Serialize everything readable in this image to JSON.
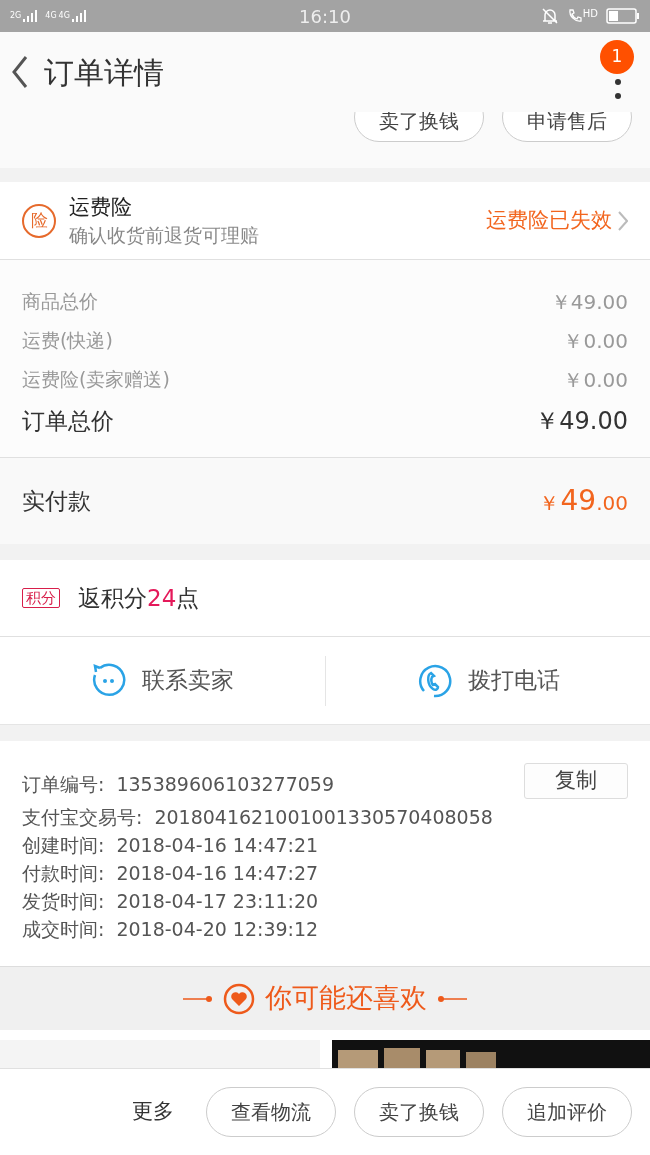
{
  "status_bar": {
    "sim1": "2G",
    "sim2": "4G",
    "sim3": "4G",
    "time": "16:10",
    "call_badge": "HD"
  },
  "header": {
    "title": "订单详情",
    "notification_count": "1"
  },
  "top_actions": [
    "卖了换钱",
    "申请售后"
  ],
  "insurance": {
    "badge": "险",
    "title": "运费险",
    "subtitle": "确认收货前退货可理赔",
    "status": "运费险已失效"
  },
  "price_lines": [
    {
      "label": "商品总价",
      "value": "￥49.00"
    },
    {
      "label": "运费(快递)",
      "value": "￥0.00"
    },
    {
      "label": "运费险(卖家赠送)",
      "value": "￥0.00"
    }
  ],
  "order_total": {
    "label": "订单总价",
    "value": "￥49.00"
  },
  "paid": {
    "label": "实付款",
    "currency": "￥",
    "integer": "49",
    "decimal": ".00"
  },
  "points": {
    "badge": "积分",
    "prefix": "返积分",
    "amount": "24",
    "suffix": "点"
  },
  "contact": [
    {
      "kind": "chat",
      "label": "联系卖家"
    },
    {
      "kind": "phone",
      "label": "拨打电话"
    }
  ],
  "order_info": [
    {
      "label": "订单编号:",
      "value": "135389606103277059"
    },
    {
      "label": "支付宝交易号:",
      "value": "2018041621001001330570408058"
    },
    {
      "label": "创建时间:",
      "value": "2018-04-16 14:47:21"
    },
    {
      "label": "付款时间:",
      "value": "2018-04-16 14:47:27"
    },
    {
      "label": "发货时间:",
      "value": "2018-04-17 23:11:20"
    },
    {
      "label": "成交时间:",
      "value": "2018-04-20 12:39:12"
    }
  ],
  "copy_button": "复制",
  "recommend_title": "你可能还喜欢",
  "bottom_bar": {
    "more": "更多",
    "buttons": [
      "查看物流",
      "卖了换钱",
      "追加评价"
    ]
  }
}
